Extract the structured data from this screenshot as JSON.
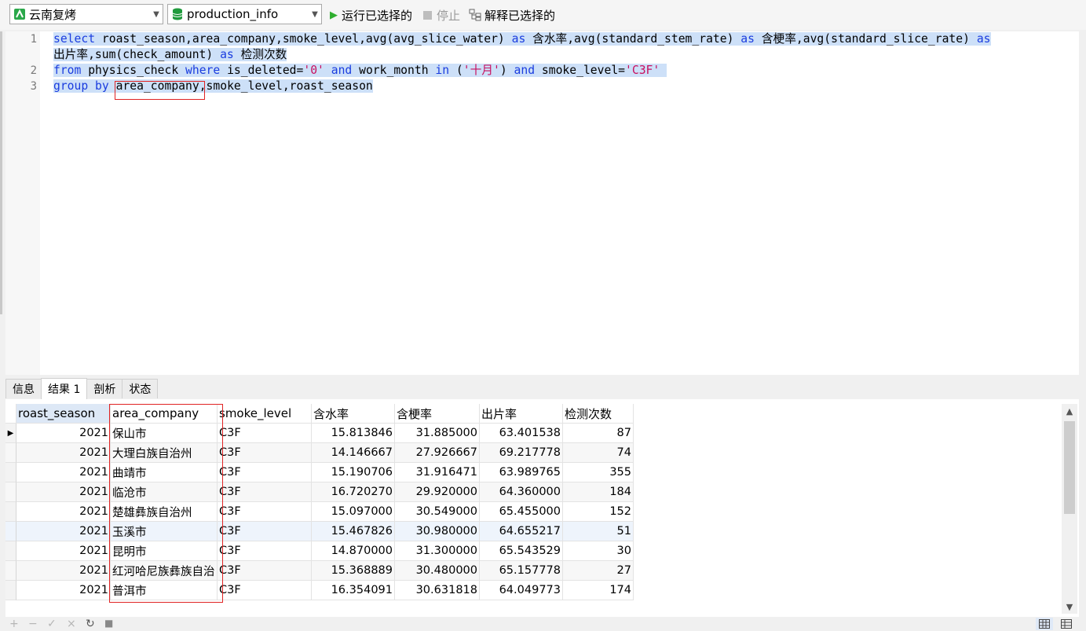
{
  "toolbar": {
    "connection": "云南复烤",
    "database": "production_info",
    "run_selected": "运行已选择的",
    "stop": "停止",
    "explain_selected": "解释已选择的"
  },
  "editor": {
    "line_numbers": [
      "1",
      "2",
      "3"
    ],
    "lines": [
      {
        "segments": [
          {
            "t": "select",
            "c": "kw"
          },
          {
            "t": " roast_season,area_company,smoke_level,avg(avg_slice_water) ",
            "c": ""
          },
          {
            "t": "as",
            "c": "kw"
          },
          {
            "t": " 含水率,avg(standard_stem_rate) ",
            "c": ""
          },
          {
            "t": "as",
            "c": "kw"
          },
          {
            "t": " 含梗率,avg(standard_slice_rate) ",
            "c": ""
          },
          {
            "t": "as",
            "c": "kw"
          }
        ]
      },
      {
        "segments": [
          {
            "t": "出片率,sum(check_amount) ",
            "c": ""
          },
          {
            "t": "as",
            "c": "kw"
          },
          {
            "t": " 检测次数",
            "c": ""
          }
        ]
      },
      {
        "segments": [
          {
            "t": "from",
            "c": "kw"
          },
          {
            "t": " physics_check ",
            "c": ""
          },
          {
            "t": "where",
            "c": "kw"
          },
          {
            "t": " is_deleted=",
            "c": ""
          },
          {
            "t": "'0'",
            "c": "str"
          },
          {
            "t": " ",
            "c": ""
          },
          {
            "t": "and",
            "c": "kw"
          },
          {
            "t": " work_month ",
            "c": ""
          },
          {
            "t": "in",
            "c": "kw"
          },
          {
            "t": " (",
            "c": ""
          },
          {
            "t": "'十月'",
            "c": "str"
          },
          {
            "t": ") ",
            "c": ""
          },
          {
            "t": "and",
            "c": "kw"
          },
          {
            "t": " smoke_level=",
            "c": ""
          },
          {
            "t": "'C3F'",
            "c": "str"
          },
          {
            "t": " ",
            "c": ""
          }
        ]
      },
      {
        "segments": [
          {
            "t": "group by",
            "c": "kw"
          },
          {
            "t": " area_company,smoke_level,roast_season",
            "c": ""
          }
        ]
      }
    ]
  },
  "tabs": [
    "信息",
    "结果 1",
    "剖析",
    "状态"
  ],
  "active_tab": "结果 1",
  "results": {
    "columns": [
      "roast_season",
      "area_company",
      "smoke_level",
      "含水率",
      "含梗率",
      "出片率",
      "检测次数"
    ],
    "rows": [
      [
        "2021",
        "保山市",
        "C3F",
        "15.813846",
        "31.885000",
        "63.401538",
        "87"
      ],
      [
        "2021",
        "大理白族自治州",
        "C3F",
        "14.146667",
        "27.926667",
        "69.217778",
        "74"
      ],
      [
        "2021",
        "曲靖市",
        "C3F",
        "15.190706",
        "31.916471",
        "63.989765",
        "355"
      ],
      [
        "2021",
        "临沧市",
        "C3F",
        "16.720270",
        "29.920000",
        "64.360000",
        "184"
      ],
      [
        "2021",
        "楚雄彝族自治州",
        "C3F",
        "15.097000",
        "30.549000",
        "65.455000",
        "152"
      ],
      [
        "2021",
        "玉溪市",
        "C3F",
        "15.467826",
        "30.980000",
        "64.655217",
        "51"
      ],
      [
        "2021",
        "昆明市",
        "C3F",
        "14.870000",
        "31.300000",
        "65.543529",
        "30"
      ],
      [
        "2021",
        "红河哈尼族彝族自治",
        "C3F",
        "15.368889",
        "30.480000",
        "65.157778",
        "27"
      ],
      [
        "2021",
        "普洱市",
        "C3F",
        "16.354091",
        "30.631818",
        "64.049773",
        "174"
      ]
    ]
  },
  "bottom_buttons": [
    "+",
    "−",
    "✓",
    "×",
    "↻",
    "■"
  ],
  "colors": {
    "keyword": "#1a3cdf",
    "string": "#c8105f",
    "selection": "#cde0f8",
    "annotation": "#e02424"
  }
}
